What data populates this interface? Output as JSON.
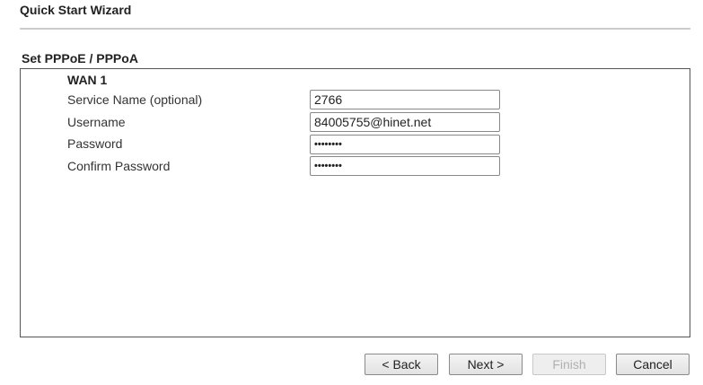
{
  "title": "Quick Start Wizard",
  "section": "Set PPPoE / PPPoA",
  "wan": "WAN 1",
  "fields": [
    {
      "label": "Service Name (optional)",
      "value": "2766"
    },
    {
      "label": "Username",
      "value": "84005755@hinet.net"
    },
    {
      "label": "Password",
      "value": "••••••••"
    },
    {
      "label": "Confirm Password",
      "value": "••••••••"
    }
  ],
  "buttons": {
    "back": "< Back",
    "next": "Next >",
    "finish": "Finish",
    "cancel": "Cancel"
  }
}
